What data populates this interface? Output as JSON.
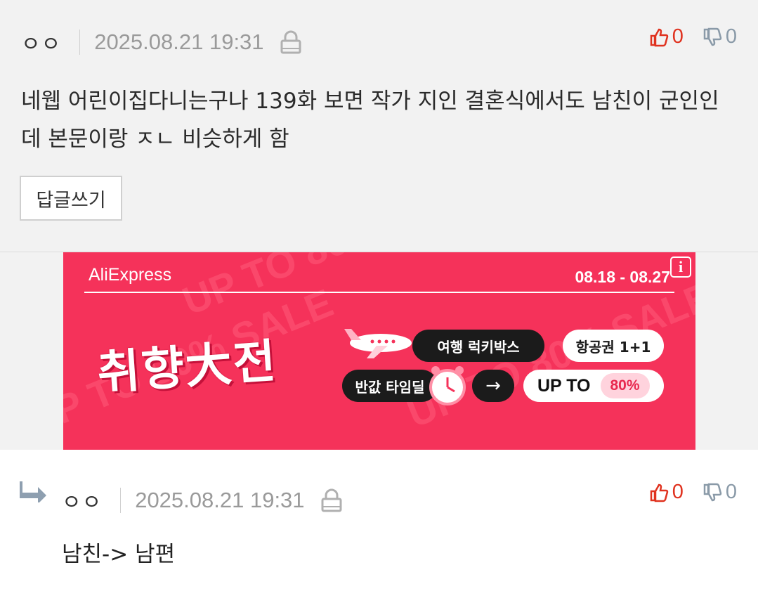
{
  "comment": {
    "nickname": "ㅇㅇ",
    "date": "2025.08.21 19:31",
    "upvotes": "0",
    "downvotes": "0",
    "body_line1": "네웹 어린이집다니는구나 139화 보면 작가 지인 결혼식에서도 남친이 군인인",
    "body_line2": "데 본문이랑 ㅈㄴ 비슷하게 함",
    "reply_button": "답글쓰기"
  },
  "ad": {
    "brand": "AliExpress",
    "dates": "08.18 - 08.27",
    "info": "i",
    "headline": "취향大전",
    "travel_luckybox": "여행 럭키박스",
    "ticket_offer": "항공권 1+1",
    "half_price": "반값 타임딜",
    "arrow": "→",
    "up_to": "UP TO",
    "percent": "80%",
    "bg_text": "UP TO 80% SALE"
  },
  "reply": {
    "nickname": "ㅇㅇ",
    "date": "2025.08.21 19:31",
    "upvotes": "0",
    "downvotes": "0",
    "body": "남친-> 남편"
  },
  "colors": {
    "upvote": "#e0321f",
    "downvote": "#8a9aa8",
    "ad_bg": "#f5325a"
  }
}
